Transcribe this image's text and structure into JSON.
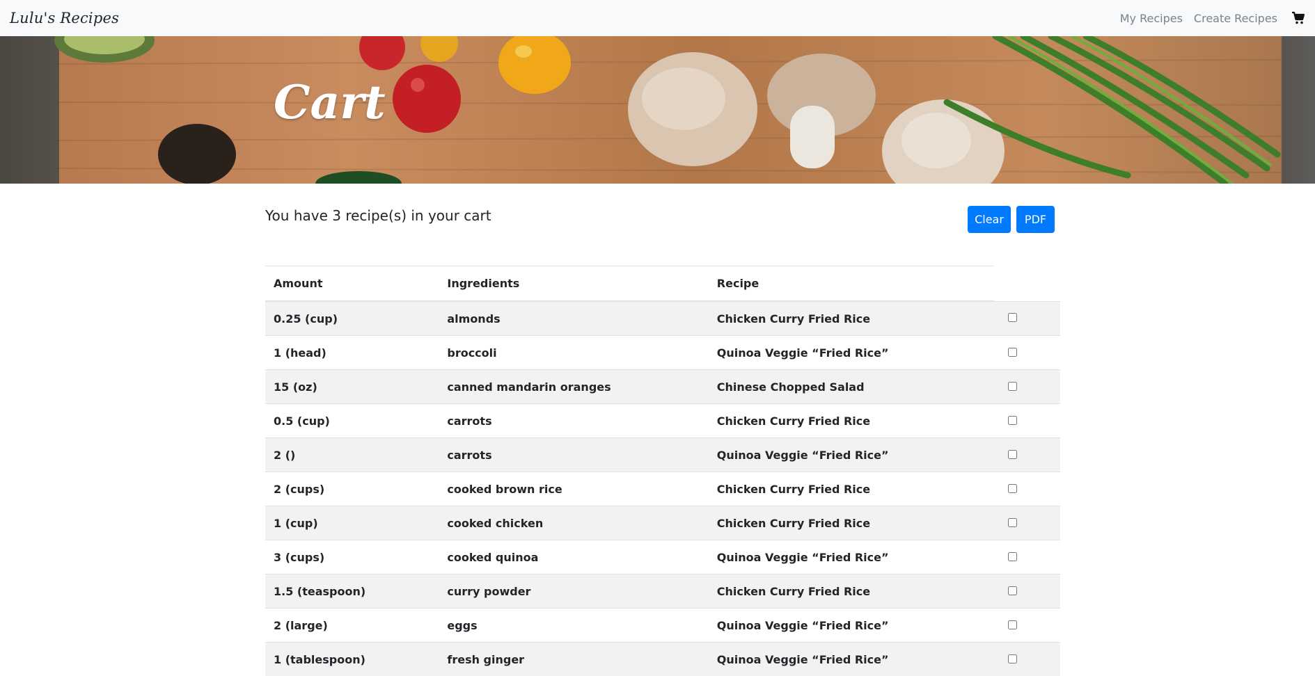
{
  "navbar": {
    "brand": "Lulu's Recipes",
    "links": [
      "My Recipes",
      "Create Recipes"
    ],
    "cart_icon": "shopping-cart-icon"
  },
  "hero": {
    "title": "Cart"
  },
  "cart": {
    "summary": "You have 3 recipe(s) in your cart",
    "clear_label": "Clear",
    "pdf_label": "PDF"
  },
  "table": {
    "headers": [
      "Amount",
      "Ingredients",
      "Recipe"
    ],
    "rows": [
      {
        "amount": "0.25 (cup)",
        "ingredient": "almonds",
        "recipe": "Chicken Curry Fried Rice"
      },
      {
        "amount": "1 (head)",
        "ingredient": "broccoli",
        "recipe": "Quinoa Veggie “Fried Rice”"
      },
      {
        "amount": "15 (oz)",
        "ingredient": "canned mandarin oranges",
        "recipe": "Chinese Chopped Salad"
      },
      {
        "amount": "0.5 (cup)",
        "ingredient": "carrots",
        "recipe": "Chicken Curry Fried Rice"
      },
      {
        "amount": "2 ()",
        "ingredient": "carrots",
        "recipe": "Quinoa Veggie “Fried Rice”"
      },
      {
        "amount": "2 (cups)",
        "ingredient": "cooked brown rice",
        "recipe": "Chicken Curry Fried Rice"
      },
      {
        "amount": "1 (cup)",
        "ingredient": "cooked chicken",
        "recipe": "Chicken Curry Fried Rice"
      },
      {
        "amount": "3 (cups)",
        "ingredient": "cooked quinoa",
        "recipe": "Quinoa Veggie “Fried Rice”"
      },
      {
        "amount": "1.5 (teaspoon)",
        "ingredient": "curry powder",
        "recipe": "Chicken Curry Fried Rice"
      },
      {
        "amount": "2 (large)",
        "ingredient": "eggs",
        "recipe": "Quinoa Veggie “Fried Rice”"
      },
      {
        "amount": "1 (tablespoon)",
        "ingredient": "fresh ginger",
        "recipe": "Quinoa Veggie “Fried Rice”"
      }
    ]
  },
  "colors": {
    "primary": "#007bff",
    "navbar_bg": "#f8f9fa",
    "nav_link": "#7d8288",
    "row_stripe": "#f2f2f2"
  }
}
